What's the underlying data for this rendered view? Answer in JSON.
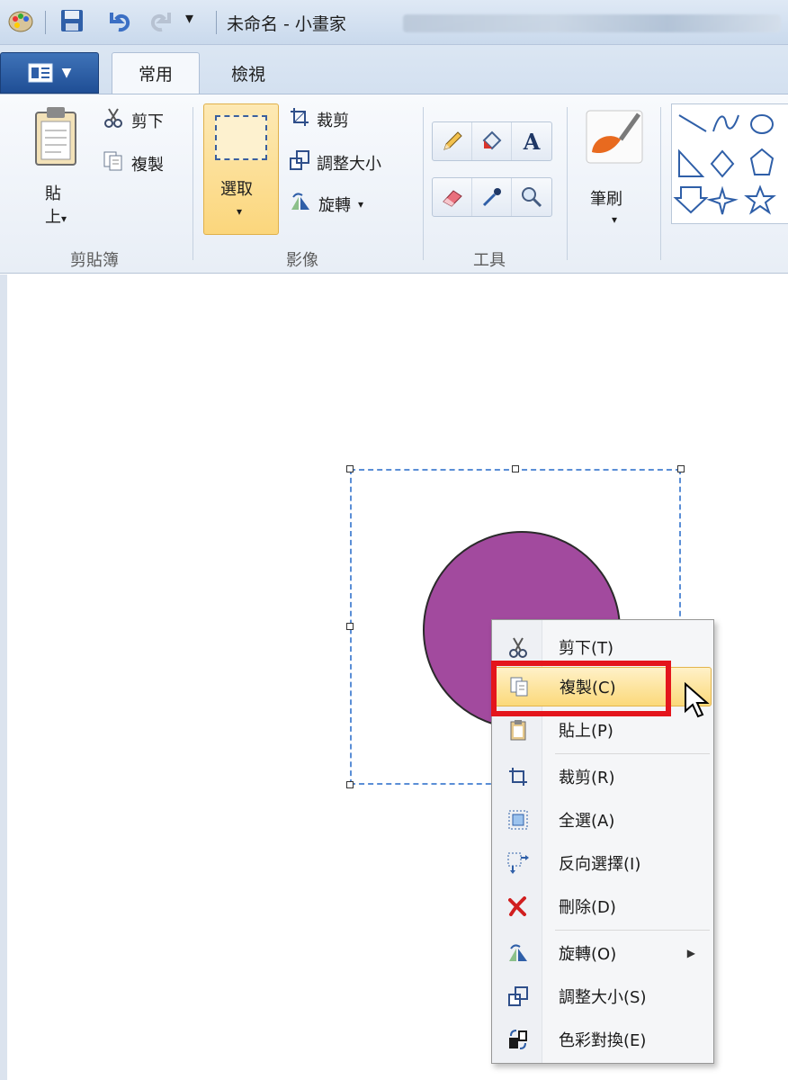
{
  "window": {
    "title": "未命名 - 小畫家"
  },
  "tabs": [
    {
      "label": "常用",
      "active": true
    },
    {
      "label": "檢視",
      "active": false
    }
  ],
  "ribbon": {
    "clipboard": {
      "label": "剪貼簿",
      "paste": "貼",
      "paste_sub": "上",
      "cut": "剪下",
      "copy": "複製"
    },
    "image": {
      "label": "影像",
      "select": "選取",
      "crop": "裁剪",
      "resize": "調整大小",
      "rotate": "旋轉"
    },
    "tools": {
      "label": "工具"
    },
    "brushes": {
      "label": "筆刷"
    }
  },
  "canvas": {
    "shape_color": "#a24a9e"
  },
  "context_menu": {
    "items": [
      {
        "label": "剪下(T)",
        "icon": "scissors-icon"
      },
      {
        "label": "複製(C)",
        "icon": "copy-icon",
        "highlighted": true
      },
      {
        "label": "貼上(P)",
        "icon": "paste-icon"
      },
      {
        "label": "裁剪(R)",
        "icon": "crop-icon"
      },
      {
        "label": "全選(A)",
        "icon": "select-all-icon"
      },
      {
        "label": "反向選擇(I)",
        "icon": "invert-selection-icon"
      },
      {
        "label": "刪除(D)",
        "icon": "delete-icon"
      },
      {
        "label": "旋轉(O)",
        "icon": "rotate-icon",
        "submenu": true
      },
      {
        "label": "調整大小(S)",
        "icon": "resize-icon"
      },
      {
        "label": "色彩對換(E)",
        "icon": "invert-color-icon"
      }
    ]
  },
  "colors": {
    "highlight_border": "#e4151c",
    "ribbon_active": "#fbd67c"
  }
}
